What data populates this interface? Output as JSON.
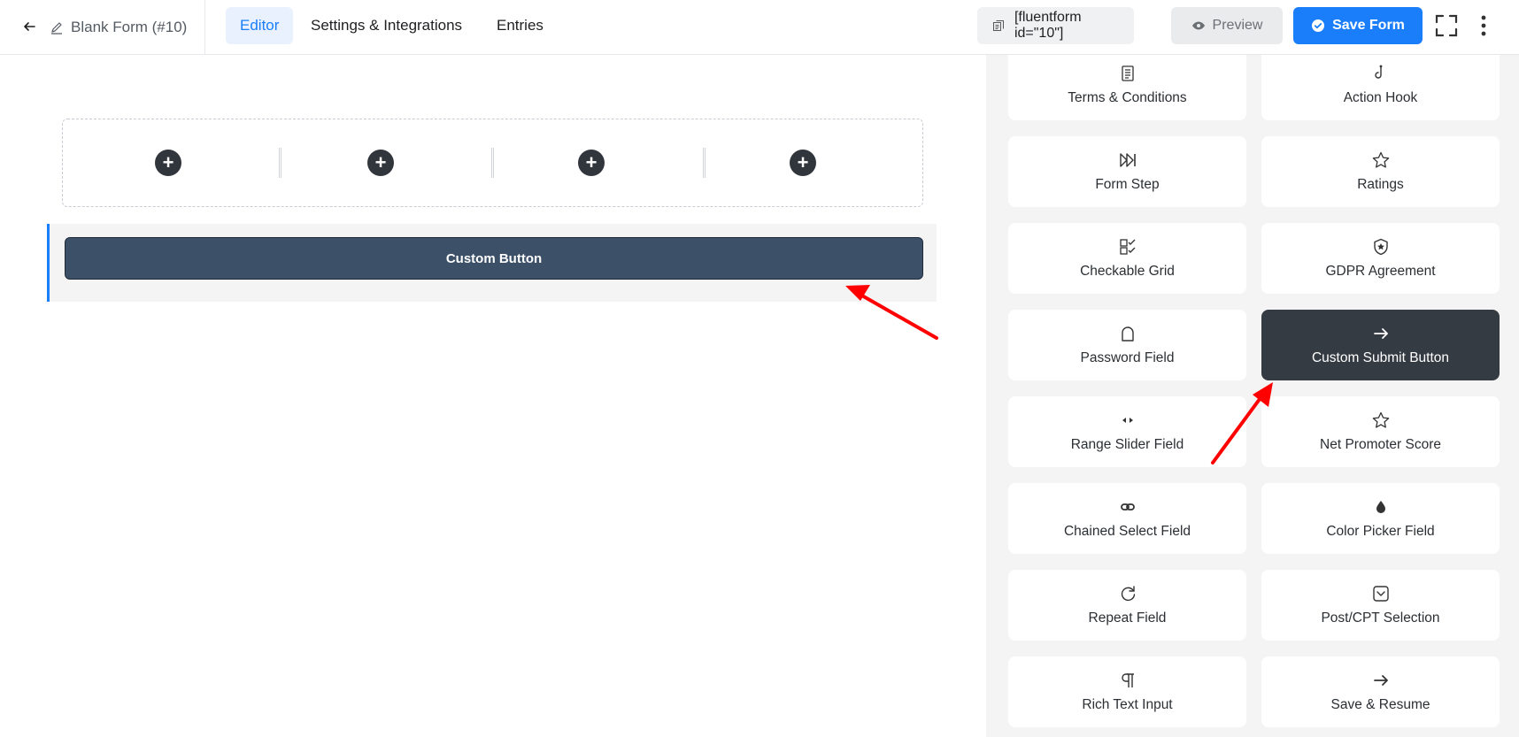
{
  "header": {
    "back_icon": "arrow-left-icon",
    "form_title": "Blank Form (#10)",
    "tabs": [
      {
        "label": "Editor",
        "active": true
      },
      {
        "label": "Settings & Integrations",
        "active": false
      },
      {
        "label": "Entries",
        "active": false
      }
    ],
    "shortcode": "[fluentform id=\"10\"]",
    "preview_label": "Preview",
    "save_label": "Save Form"
  },
  "canvas": {
    "columns": 4,
    "custom_button_label": "Custom Button"
  },
  "sidebar": {
    "fields": [
      {
        "label": "Terms & Conditions",
        "icon": "document-icon"
      },
      {
        "label": "Action Hook",
        "icon": "hook-icon"
      },
      {
        "label": "Form Step",
        "icon": "fast-forward-icon"
      },
      {
        "label": "Ratings",
        "icon": "star-icon"
      },
      {
        "label": "Checkable Grid",
        "icon": "checkable-grid-icon"
      },
      {
        "label": "GDPR Agreement",
        "icon": "shield-icon"
      },
      {
        "label": "Password Field",
        "icon": "lock-icon"
      },
      {
        "label": "Custom Submit Button",
        "icon": "arrow-right-icon",
        "selected": true
      },
      {
        "label": "Range Slider Field",
        "icon": "range-slider-icon"
      },
      {
        "label": "Net Promoter Score",
        "icon": "star-outline-icon"
      },
      {
        "label": "Chained Select Field",
        "icon": "link-icon"
      },
      {
        "label": "Color Picker Field",
        "icon": "drop-icon"
      },
      {
        "label": "Repeat Field",
        "icon": "repeat-icon"
      },
      {
        "label": "Post/CPT Selection",
        "icon": "post-selection-icon"
      },
      {
        "label": "Rich Text Input",
        "icon": "paragraph-icon"
      },
      {
        "label": "Save & Resume",
        "icon": "arrow-right-icon"
      }
    ]
  },
  "colors": {
    "accent": "#1a7efb",
    "annotation_arrow": "#ff0000",
    "button_bg": "#3c5068",
    "selected_card": "#353b43"
  }
}
